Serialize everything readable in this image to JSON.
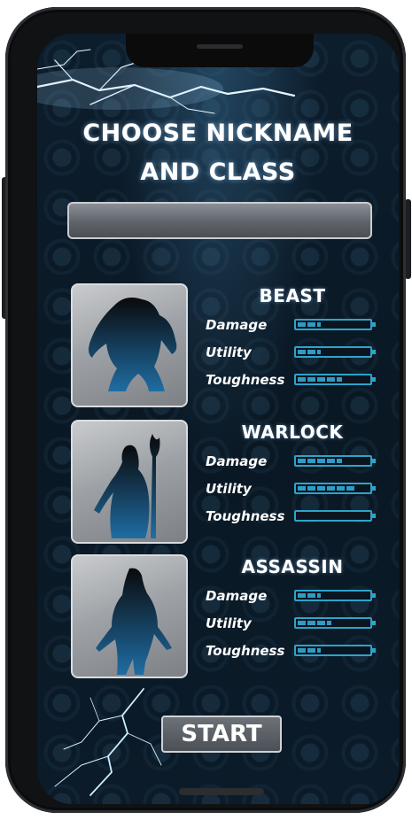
{
  "title": {
    "line1": "CHOOSE NICKNAME",
    "line2": "AND CLASS"
  },
  "nickname": {
    "value": "",
    "placeholder": ""
  },
  "classes": [
    {
      "name": "BEAST",
      "stats": [
        {
          "label": "Damage",
          "level": 0.33
        },
        {
          "label": "Utility",
          "level": 0.33
        },
        {
          "label": "Toughness",
          "level": 0.67
        }
      ]
    },
    {
      "name": "WARLOCK",
      "stats": [
        {
          "label": "Damage",
          "level": 0.67
        },
        {
          "label": "Utility",
          "level": 1.0
        },
        {
          "label": "Toughness",
          "level": 0.0
        }
      ]
    },
    {
      "name": "ASSASSIN",
      "stats": [
        {
          "label": "Damage",
          "level": 0.33
        },
        {
          "label": "Utility",
          "level": 0.67
        },
        {
          "label": "Toughness",
          "level": 0.33
        }
      ]
    }
  ],
  "start_label": "START",
  "colors": {
    "accent": "#2fa3c9",
    "background": "#0b1b29",
    "text": "#ffffff"
  },
  "icons": [
    "beast-silhouette-icon",
    "warlock-silhouette-icon",
    "assassin-silhouette-icon",
    "lightning-icon"
  ]
}
